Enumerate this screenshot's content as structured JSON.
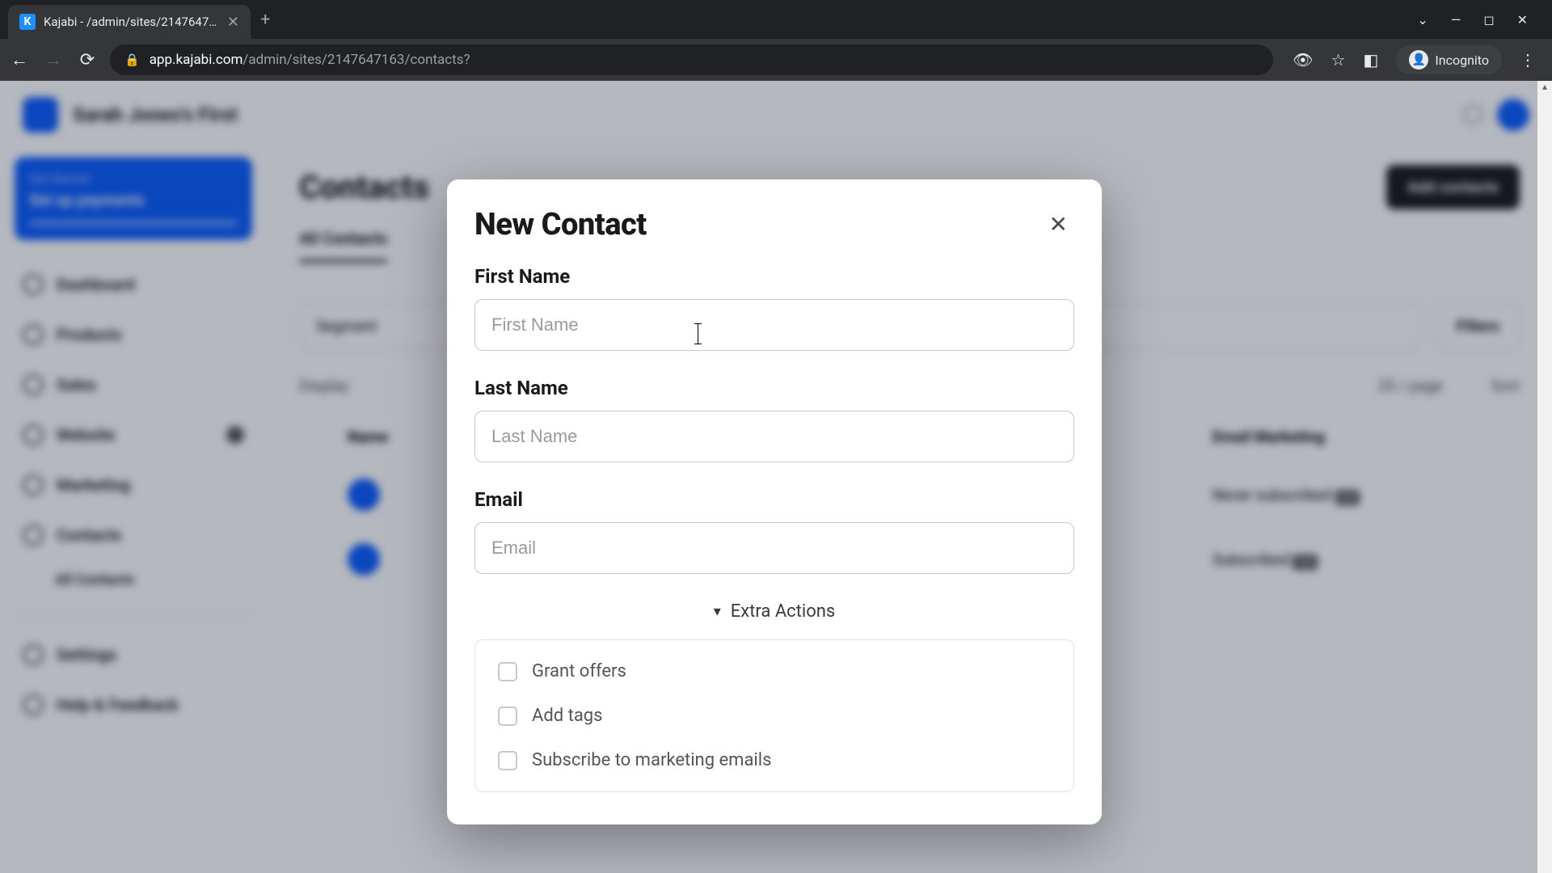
{
  "browser": {
    "tab_title": "Kajabi - /admin/sites/2147647163",
    "favicon_letter": "K",
    "url_host": "app.kajabi.com",
    "url_path": "/admin/sites/2147647163/contacts?",
    "incognito_label": "Incognito"
  },
  "bg": {
    "site_name": "Sarah Jones's First",
    "banner_eyebrow": "Get Started",
    "banner_title": "Set up payments",
    "nav": [
      "Dashboard",
      "Products",
      "Sales",
      "Website",
      "Marketing",
      "Contacts"
    ],
    "subnav": "All Contacts",
    "nav_footer": [
      "Settings",
      "Help & Feedback"
    ],
    "main_title": "Contacts",
    "add_button": "Add contacts",
    "tab_label": "All Contacts",
    "segment_placeholder": "Segment",
    "filters_label": "Filters",
    "meta_display": "Display",
    "meta_perpage": "25 / page",
    "meta_sort": "Sort",
    "th_name": "Name",
    "th_em": "Email Marketing",
    "row1_text": "Never subscribed",
    "row2_text": "Subscribed",
    "pill": "me"
  },
  "modal": {
    "title": "New Contact",
    "first_name_label": "First Name",
    "first_name_placeholder": "First Name",
    "last_name_label": "Last Name",
    "last_name_placeholder": "Last Name",
    "email_label": "Email",
    "email_placeholder": "Email",
    "extra_actions_label": "Extra Actions",
    "grant_offers": "Grant offers",
    "add_tags": "Add tags",
    "subscribe": "Subscribe to marketing emails"
  }
}
